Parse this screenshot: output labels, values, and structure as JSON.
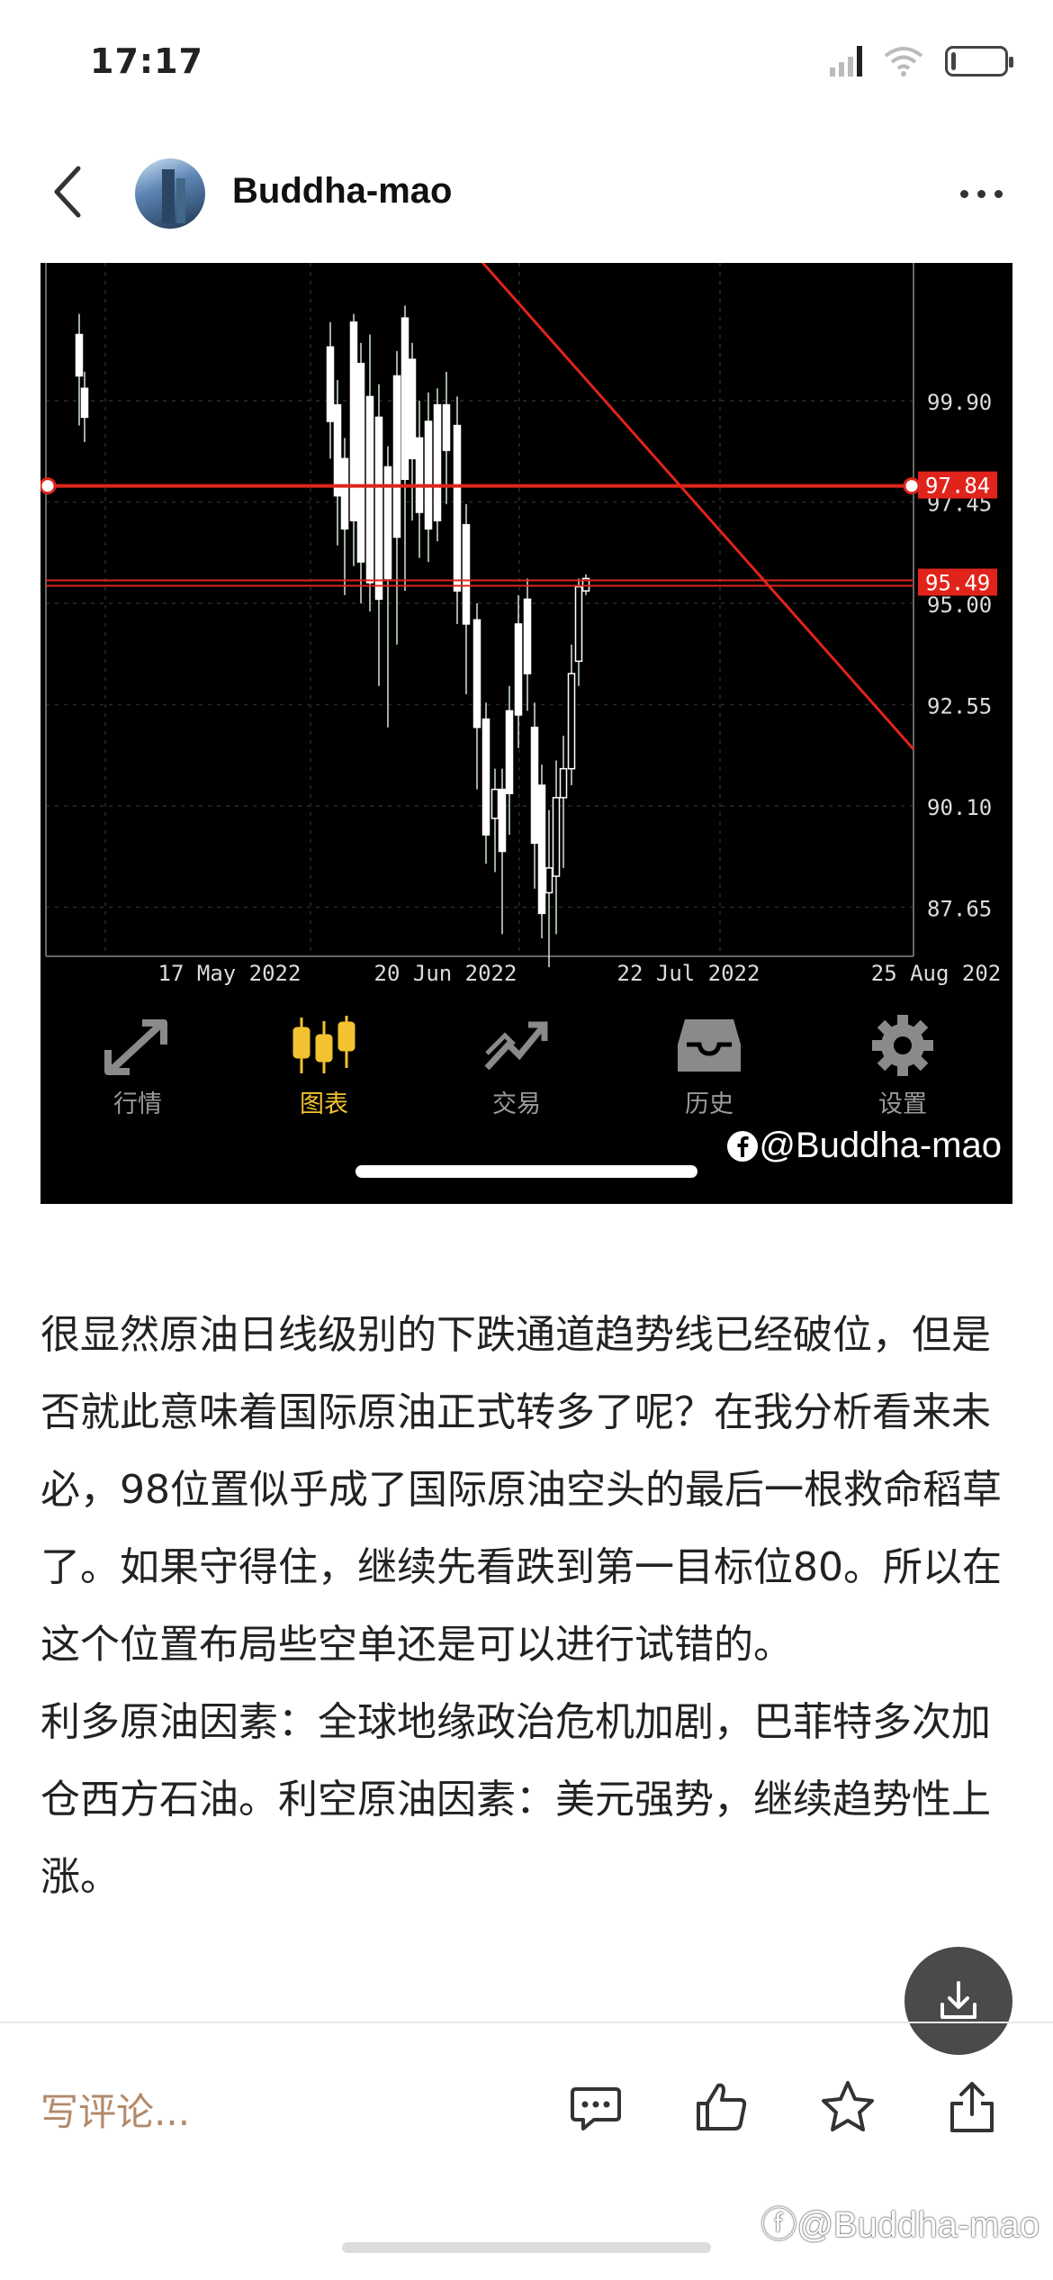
{
  "status_bar": {
    "time": "17:17"
  },
  "header": {
    "user_name": "Buddha-mao"
  },
  "chart_data": {
    "type": "candlestick",
    "y_ticks": [
      "99.90",
      "97.45",
      "95.00",
      "92.55",
      "90.10",
      "87.65"
    ],
    "x_ticks": [
      "17 May 2022",
      "20 Jun 2022",
      "22 Jul 2022",
      "25 Aug 202"
    ],
    "price_lines": [
      {
        "label": "97.84",
        "value": 97.84,
        "color": "#e0241b"
      },
      {
        "label": "95.49",
        "value": 95.49,
        "color": "#e0241b"
      }
    ],
    "trendline_color": "#e0241b",
    "grid": true,
    "candle_color": "#ffffff"
  },
  "app_tabbar": {
    "tabs": [
      {
        "label": "行情",
        "icon": "quotes-arrows-icon",
        "active": false
      },
      {
        "label": "图表",
        "icon": "candlestick-chart-icon",
        "active": true
      },
      {
        "label": "交易",
        "icon": "trade-trend-icon",
        "active": false
      },
      {
        "label": "历史",
        "icon": "history-inbox-icon",
        "active": false
      },
      {
        "label": "设置",
        "icon": "settings-gear-icon",
        "active": false
      }
    ],
    "watermark": "@Buddha-mao"
  },
  "article": {
    "paragraphs": [
      "很显然原油日线级别的下跌通道趋势线已经破位，但是否就此意味着国际原油正式转多了呢？在我分析看来未必，98位置似乎成了国际原油空头的最后一根救命稻草了。如果守得住，继续先看跌到第一目标位80。所以在这个位置布局些空单还是可以进行试错的。",
      "利多原油因素：全球地缘政治危机加剧，巴菲特多次加仓西方石油。利空原油因素：美元强势，继续趋势性上涨。"
    ]
  },
  "bottom_bar": {
    "comment_placeholder": "写评论..."
  },
  "watermark": "@Buddha-mao"
}
